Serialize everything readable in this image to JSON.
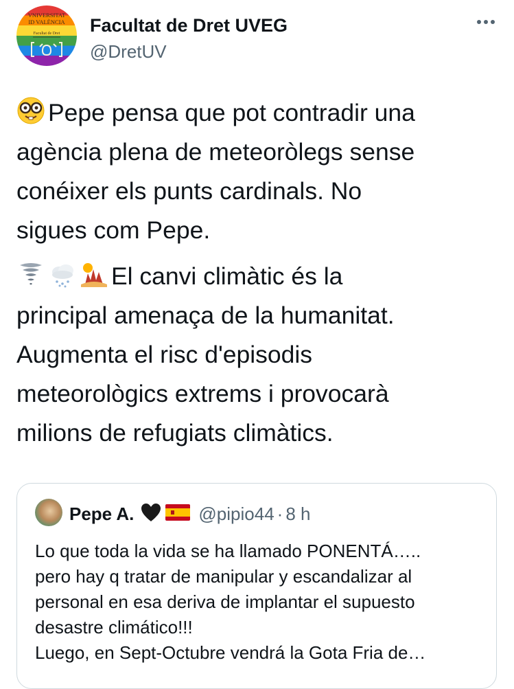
{
  "tweet": {
    "author_name": "Facultat de Dret UVEG",
    "author_handle": "@DretUV",
    "avatar_icon": "university-logo-rainbow",
    "avatar_logo_text": [
      "VNIVERSITAT",
      "ID VALÈNCIA",
      "Facultat de Dret"
    ],
    "more_icon": "more-horizontal-icon",
    "paragraph1": {
      "emoji": "nerd-face-emoji",
      "lines": [
        "Pepe pensa que pot contradir una",
        "agència plena de meteoròlegs sense",
        "conéixer els punts cardinals. No",
        "sigues com Pepe."
      ]
    },
    "paragraph2": {
      "emojis": [
        "tornado-emoji",
        "cloud-snow-emoji",
        "desert-sun-emoji"
      ],
      "lines": [
        "El canvi climàtic és la",
        "principal amenaça de la humanitat.",
        "Augmenta el risc d'episodis",
        "meteorològics extrems i provocarà",
        "milions de refugiats climàtics."
      ]
    }
  },
  "quoted_tweet": {
    "author_name": "Pepe A.",
    "emojis": [
      "black-heart-emoji",
      "spain-flag-emoji"
    ],
    "author_handle": "@pipio44",
    "separator": "·",
    "time": "8 h",
    "lines": [
      "Lo que toda la vida se ha llamado PONENTÁ…..",
      "pero hay q tratar de manipular y escandalizar al",
      "personal en esa deriva de implantar el supuesto",
      "desastre climático!!!",
      "Luego, en Sept-Octubre vendrá la Gota Fria de…"
    ]
  },
  "colors": {
    "text_primary": "#0f1419",
    "text_secondary": "#536471",
    "border": "#cfd9de"
  }
}
